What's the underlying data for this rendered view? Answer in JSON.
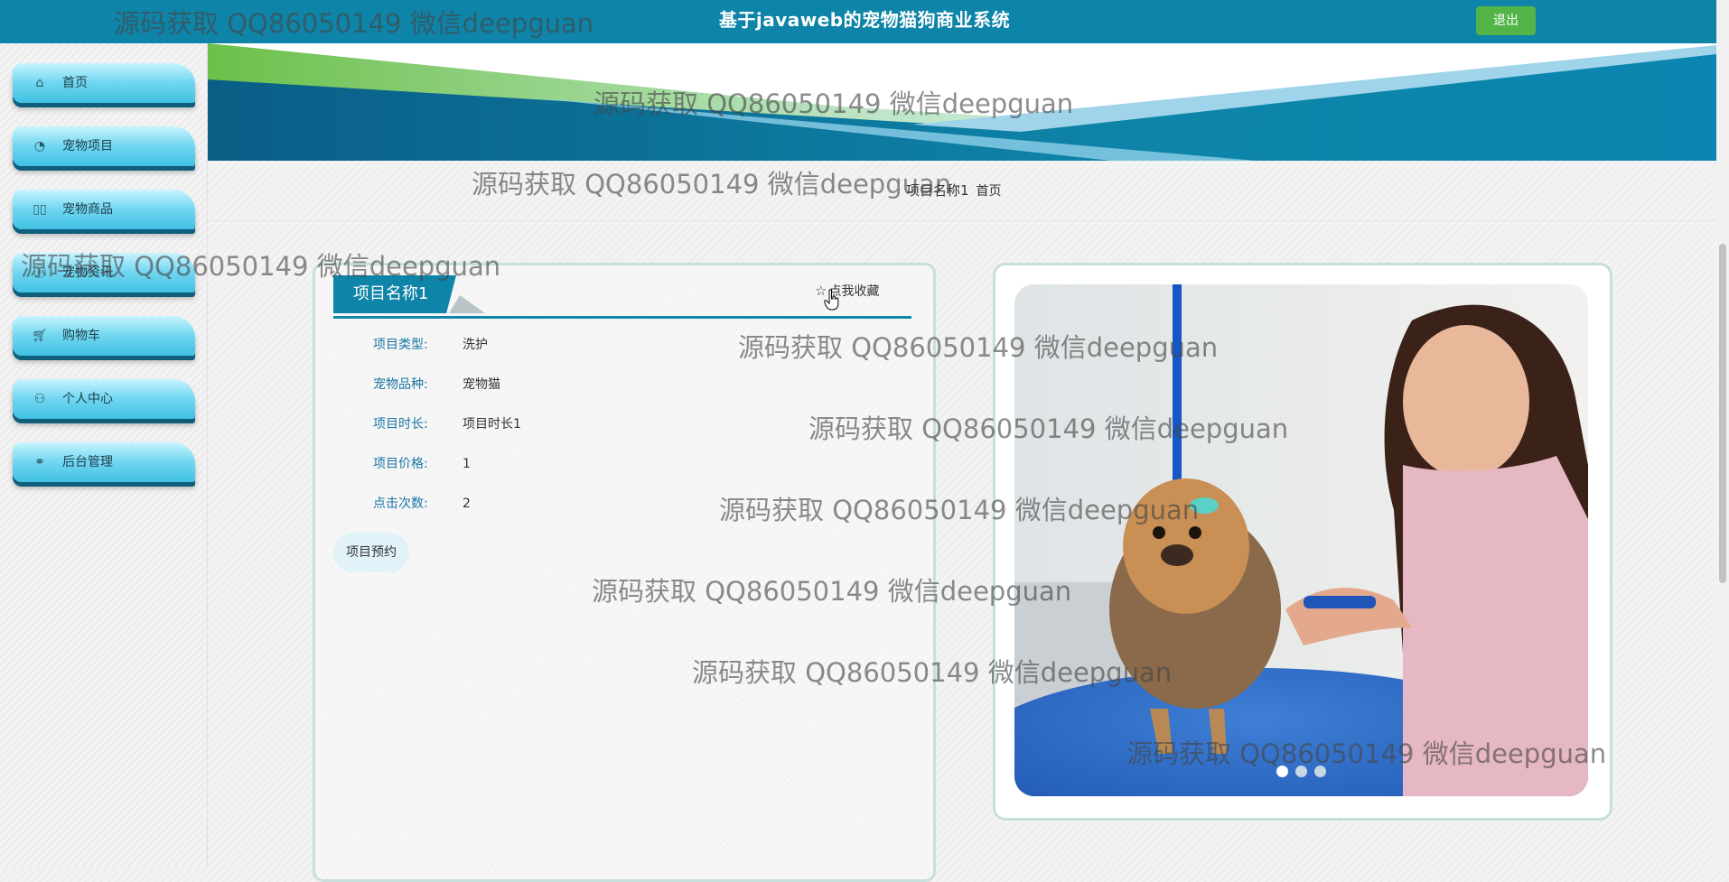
{
  "header": {
    "title": "基于javaweb的宠物猫狗商业系统",
    "logout_label": "退出",
    "bar_color": "#0e84a8",
    "logout_color": "#53b448"
  },
  "sidebar": {
    "items": [
      {
        "label": "首页",
        "icon": "home-icon"
      },
      {
        "label": "宠物项目",
        "icon": "palette-icon"
      },
      {
        "label": "宠物商品",
        "icon": "columns-icon"
      },
      {
        "label": "宠物资讯",
        "icon": "info-icon"
      },
      {
        "label": "购物车",
        "icon": "cart-icon"
      },
      {
        "label": "个人中心",
        "icon": "user-icon"
      },
      {
        "label": "后台管理",
        "icon": "link-icon"
      }
    ]
  },
  "breadcrumb": {
    "current": "项目名称1",
    "home": "首页"
  },
  "detail": {
    "title": "项目名称1",
    "favorite_label": "点我收藏",
    "fields": [
      {
        "label": "项目类型:",
        "value": "洗护"
      },
      {
        "label": "宠物品种:",
        "value": "宠物猫"
      },
      {
        "label": "项目时长:",
        "value": "项目时长1"
      },
      {
        "label": "项目价格:",
        "value": "1"
      },
      {
        "label": "点击次数:",
        "value": "2"
      }
    ],
    "book_label": "项目预约"
  },
  "carousel": {
    "slide_count": 3,
    "active_index": 0
  },
  "watermark": {
    "text": "源码获取 QQ86050149 微信deepguan"
  }
}
